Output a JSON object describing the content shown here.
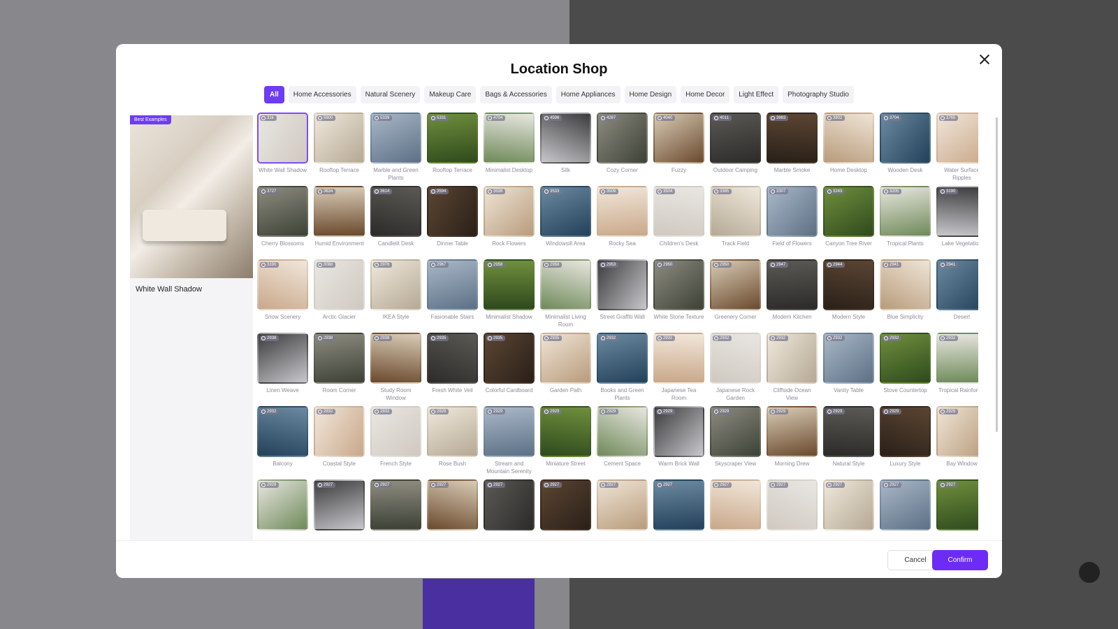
{
  "modal": {
    "title": "Location Shop",
    "close_icon": "close-icon",
    "tabs": [
      "All",
      "Home Accessories",
      "Natural Scenery",
      "Makeup Care",
      "Bags & Accessories",
      "Home Appliances",
      "Home Design",
      "Home Decor",
      "Light Effect",
      "Photography Studio"
    ],
    "active_tab": "All",
    "preview": {
      "badge": "Best Examples",
      "name": "White Wall Shadow"
    },
    "selected_item": "White Wall Shadow",
    "items": [
      {
        "name": "White Wall Shadow",
        "count": "31k"
      },
      {
        "name": "Rooftop Terrace",
        "count": "5800"
      },
      {
        "name": "Marble and Green Plants",
        "count": "5339"
      },
      {
        "name": "Rooftop Terrace",
        "count": "5331"
      },
      {
        "name": "Minimalist Desktop",
        "count": "4704"
      },
      {
        "name": "Silk",
        "count": "4596"
      },
      {
        "name": "Cozy Corner",
        "count": "4287"
      },
      {
        "name": "Fuzzy",
        "count": "4040"
      },
      {
        "name": "Outdoor Camping",
        "count": "4011"
      },
      {
        "name": "Marble Smoke",
        "count": "3983"
      },
      {
        "name": "Home Desktop",
        "count": "3802"
      },
      {
        "name": "Wooden Desk",
        "count": "3704"
      },
      {
        "name": "Water Surface Ripples",
        "count": "3765"
      },
      {
        "name": "Cherry Blossoms",
        "count": "3727"
      },
      {
        "name": "Humid Environment",
        "count": "3634"
      },
      {
        "name": "Candlelit Desk",
        "count": "3614"
      },
      {
        "name": "Dinner Table",
        "count": "3594"
      },
      {
        "name": "Rock Flowers",
        "count": "3538"
      },
      {
        "name": "Windowsill Area",
        "count": "3533"
      },
      {
        "name": "Rocky Sea",
        "count": "3509"
      },
      {
        "name": "Children's Desk",
        "count": "3504"
      },
      {
        "name": "Track Field",
        "count": "3385"
      },
      {
        "name": "Field of Flowers",
        "count": "3307"
      },
      {
        "name": "Canyon Tree River",
        "count": "3243"
      },
      {
        "name": "Tropical Plants",
        "count": "3205"
      },
      {
        "name": "Lake Vegetation",
        "count": "3190"
      },
      {
        "name": "Snow Scenery",
        "count": "3190"
      },
      {
        "name": "Arctic Glacier",
        "count": "3088"
      },
      {
        "name": "IKEA Style",
        "count": "2976"
      },
      {
        "name": "Fasionable Stairs",
        "count": "2967"
      },
      {
        "name": "Minimalist Shadow",
        "count": "2958"
      },
      {
        "name": "Minimalist Living Room",
        "count": "2958"
      },
      {
        "name": "Street Graffiti Wall",
        "count": "2953"
      },
      {
        "name": "White Stone Texture",
        "count": "2950"
      },
      {
        "name": "Greenery Corner",
        "count": "2950"
      },
      {
        "name": "Modern Kitchen",
        "count": "2947"
      },
      {
        "name": "Modern Style",
        "count": "2944"
      },
      {
        "name": "Blue Simplicity",
        "count": "2941"
      },
      {
        "name": "Desert",
        "count": "2941"
      },
      {
        "name": "Linen Weave",
        "count": "2938"
      },
      {
        "name": "Room Corner",
        "count": "2938"
      },
      {
        "name": "Study Room Window",
        "count": "2938"
      },
      {
        "name": "Fresh White Veil",
        "count": "2935"
      },
      {
        "name": "Colorful Cardboard",
        "count": "2935"
      },
      {
        "name": "Garden Path",
        "count": "2935"
      },
      {
        "name": "Books and Green Plants",
        "count": "2932"
      },
      {
        "name": "Japanese Tea Room",
        "count": "2932"
      },
      {
        "name": "Japanese Rock Garden",
        "count": "2932"
      },
      {
        "name": "Cliffside Ocean View",
        "count": "2932"
      },
      {
        "name": "Vanity Table",
        "count": "2932"
      },
      {
        "name": "Stove Countertop",
        "count": "2932"
      },
      {
        "name": "Tropical Rainforest",
        "count": "2932"
      },
      {
        "name": "Balcony",
        "count": "2932"
      },
      {
        "name": "Coastal Style",
        "count": "2932"
      },
      {
        "name": "French Style",
        "count": "2932"
      },
      {
        "name": "Rose Bush",
        "count": "2929"
      },
      {
        "name": "Stream and Mountain Serenity",
        "count": "2929"
      },
      {
        "name": "Miniature Street",
        "count": "2929"
      },
      {
        "name": "Cement Space",
        "count": "2929"
      },
      {
        "name": "Warm Brick Wall",
        "count": "2929"
      },
      {
        "name": "Skyscraper View",
        "count": "2929"
      },
      {
        "name": "Morning Drew",
        "count": "2929"
      },
      {
        "name": "Natural Style",
        "count": "2929"
      },
      {
        "name": "Luxury Style",
        "count": "2929"
      },
      {
        "name": "Bay Window",
        "count": "2929"
      },
      {
        "name": "",
        "count": "2929"
      },
      {
        "name": "",
        "count": "2927"
      },
      {
        "name": "",
        "count": "2927"
      },
      {
        "name": "",
        "count": "2927"
      },
      {
        "name": "",
        "count": "2927"
      },
      {
        "name": "",
        "count": "2927"
      },
      {
        "name": "",
        "count": "2927"
      },
      {
        "name": "",
        "count": "2927"
      },
      {
        "name": "",
        "count": "2927"
      },
      {
        "name": "",
        "count": "2927"
      },
      {
        "name": "",
        "count": "2927"
      },
      {
        "name": "",
        "count": "2927"
      },
      {
        "name": "",
        "count": "2927"
      }
    ],
    "cancel_label": "Cancel",
    "confirm_label": "Confirm",
    "accent_color": "#6d2cf5"
  }
}
